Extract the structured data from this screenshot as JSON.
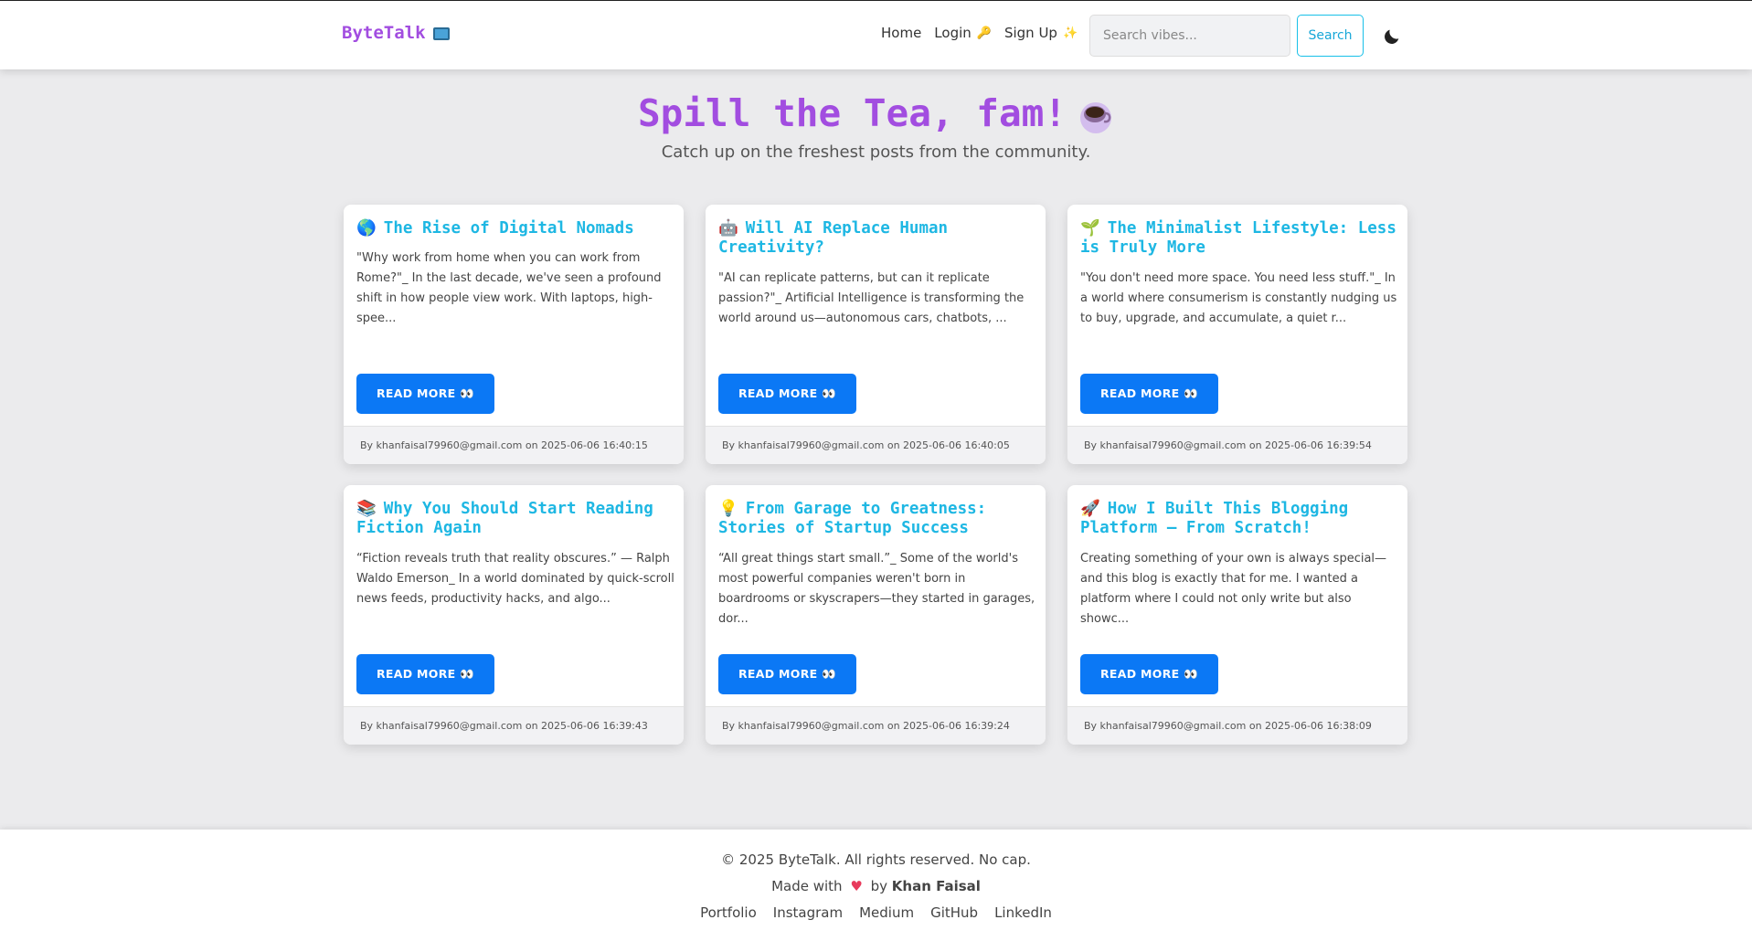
{
  "nav": {
    "brand": "ByteTalk",
    "links": [
      {
        "label": "Home",
        "emoji": ""
      },
      {
        "label": "Login",
        "emoji": "🔑"
      },
      {
        "label": "Sign Up",
        "emoji": "✨"
      }
    ],
    "search_placeholder": "Search vibes...",
    "search_button": "Search",
    "theme_toggle_icon": "moon-icon"
  },
  "hero": {
    "title": "Spill the Tea, fam!",
    "subtitle": "Catch up on the freshest posts from the community."
  },
  "read_more_label": "READ MORE 👀",
  "posts": [
    {
      "emoji": "🌎",
      "title": "The Rise of Digital Nomads",
      "excerpt": "\"Why work from home when you can work from Rome?\"_ In the last decade, we've seen a profound shift in how people view work. With laptops, high-spee...",
      "meta": "By khanfaisal79960@gmail.com on 2025-06-06 16:40:15"
    },
    {
      "emoji": "🤖",
      "title": "Will AI Replace Human Creativity?",
      "excerpt": "\"AI can replicate patterns, but can it replicate passion?\"_ Artificial Intelligence is transforming the world around us—autonomous cars, chatbots, ...",
      "meta": "By khanfaisal79960@gmail.com on 2025-06-06 16:40:05"
    },
    {
      "emoji": "🌱",
      "title": "The Minimalist Lifestyle: Less is Truly More",
      "excerpt": "\"You don't need more space. You need less stuff.\"_ In a world where consumerism is constantly nudging us to buy, upgrade, and accumulate, a quiet r...",
      "meta": "By khanfaisal79960@gmail.com on 2025-06-06 16:39:54"
    },
    {
      "emoji": "📚",
      "title": "Why You Should Start Reading Fiction Again",
      "excerpt": "“Fiction reveals truth that reality obscures.” — Ralph Waldo Emerson_ In a world dominated by quick-scroll news feeds, productivity hacks, and algo...",
      "meta": "By khanfaisal79960@gmail.com on 2025-06-06 16:39:43"
    },
    {
      "emoji": "💡",
      "title": "From Garage to Greatness: Stories of Startup Success",
      "excerpt": "“All great things start small.”_ Some of the world's most powerful companies weren't born in boardrooms or skyscrapers—they started in garages, dor...",
      "meta": "By khanfaisal79960@gmail.com on 2025-06-06 16:39:24"
    },
    {
      "emoji": "🚀",
      "title": "How I Built This Blogging Platform — From Scratch!",
      "excerpt": "Creating something of your own is always special—and this blog is exactly that for me. I wanted a platform where I could not only write but also showc...",
      "meta": "By khanfaisal79960@gmail.com on 2025-06-06 16:38:09"
    }
  ],
  "footer": {
    "copyright": "© 2025 ByteTalk. All rights reserved. No cap.",
    "made_with_prefix": "Made with",
    "made_with_by": "by",
    "author": "Khan Faisal",
    "links": [
      "Portfolio",
      "Instagram",
      "Medium",
      "GitHub",
      "LinkedIn"
    ]
  },
  "colors": {
    "brand": "#a24de0",
    "title_accent": "#1eb7e3",
    "button": "#0b78f5",
    "background": "#ebebed"
  }
}
